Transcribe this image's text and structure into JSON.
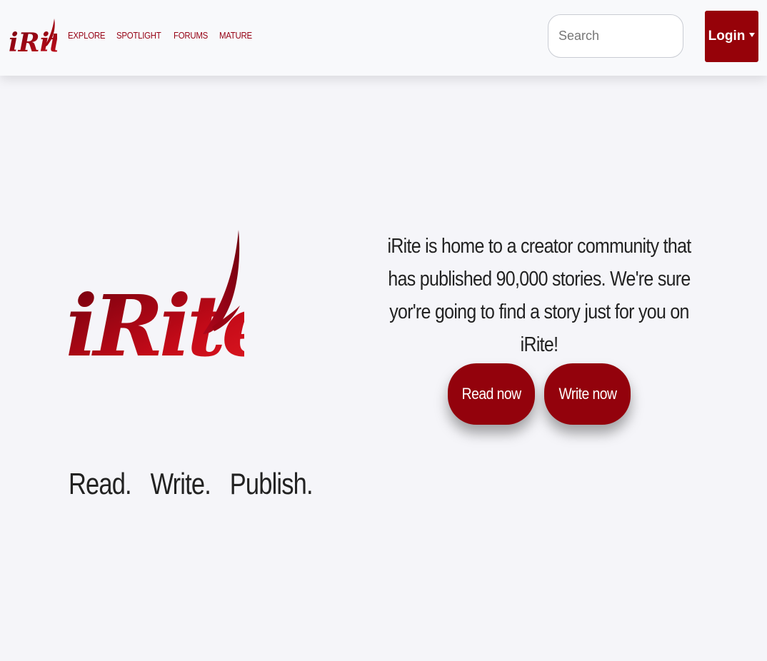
{
  "brand": {
    "logo_text": "iRite",
    "accent_color": "#960214"
  },
  "nav": {
    "links": [
      {
        "label": "EXPLORE"
      },
      {
        "label": "SPOTLIGHT"
      },
      {
        "label": "FORUMS"
      },
      {
        "label": "MATURE"
      }
    ],
    "search_placeholder": "Search",
    "login_label": "Login",
    "login_icon": "caret-down-icon"
  },
  "hero": {
    "tagline": [
      "Read.",
      "Write.",
      "Publish."
    ],
    "description": "iRite is home to a creator community that has published 90,000 stories. We're sure yor're going to find a story just for you on iRite!",
    "read_button": "Read now",
    "write_button": "Write now"
  }
}
